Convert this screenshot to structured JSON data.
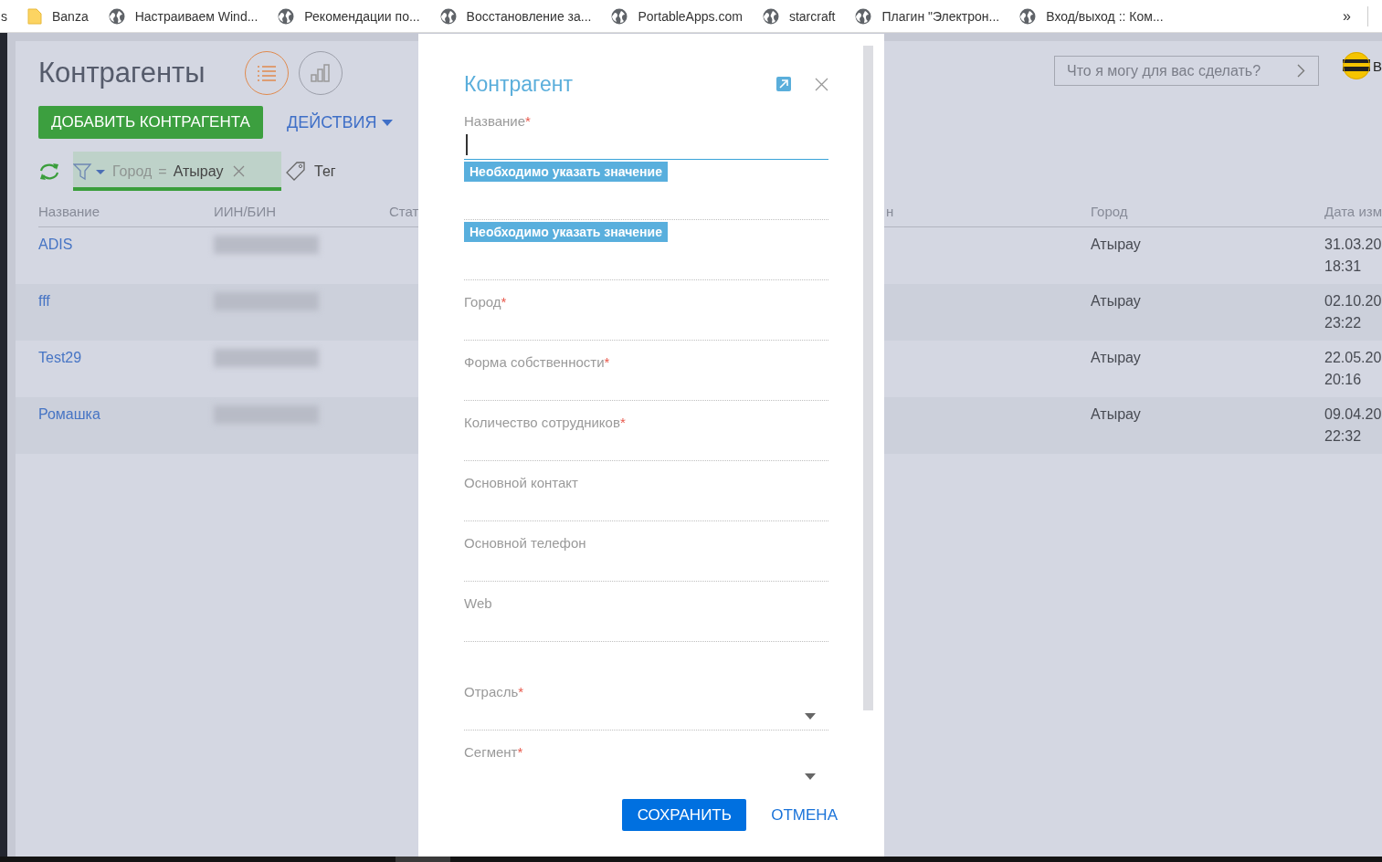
{
  "bookmarks": [
    {
      "label": "s",
      "kind": "plain"
    },
    {
      "label": "Banza",
      "kind": "folder"
    },
    {
      "label": "Настраиваем Wind...",
      "kind": "site"
    },
    {
      "label": "Рекомендации по...",
      "kind": "site"
    },
    {
      "label": "Восстановление за...",
      "kind": "site"
    },
    {
      "label": "PortableApps.com",
      "kind": "site"
    },
    {
      "label": "starcraft",
      "kind": "site"
    },
    {
      "label": "Плагин \"Электрон...",
      "kind": "site"
    },
    {
      "label": "Вход/выход :: Ком...",
      "kind": "site"
    }
  ],
  "bookmarks_more": "»",
  "page": {
    "title": "Контрагенты",
    "views": [
      {
        "kind": "list",
        "selected": true
      },
      {
        "kind": "chart",
        "selected": false
      }
    ],
    "add_button": "ДОБАВИТЬ КОНТРАГЕНТА",
    "actions": "ДЕЙСТВИЯ",
    "filter": {
      "field": "Город",
      "operator": "=",
      "value": "Атырау"
    },
    "tag": "Тег",
    "assistant": {
      "placeholder": "Что я могу для вас сделать?"
    },
    "logo_text": "B"
  },
  "table": {
    "columns": [
      "Название",
      "ИИН/БИН",
      "Стат",
      "н",
      "Город",
      "Дата изм"
    ],
    "rows": [
      {
        "name": "ADIS",
        "city": "Атырау",
        "date": "31.03.20",
        "time": "18:31"
      },
      {
        "name": "fff",
        "city": "Атырау",
        "date": "02.10.20",
        "time": "23:22"
      },
      {
        "name": "Test29",
        "city": "Атырау",
        "date": "22.05.20",
        "time": "20:16"
      },
      {
        "name": "Ромашка",
        "city": "Атырау",
        "date": "09.04.20",
        "time": "22:32"
      }
    ]
  },
  "dialog": {
    "title": "Контрагент",
    "required_mark": "*",
    "fields": [
      {
        "label": "Название",
        "required": true,
        "kind": "text",
        "focused": true,
        "error": "Необходимо указать значение"
      },
      {
        "kind": "text",
        "focused": false,
        "error": "Необходимо указать значение"
      },
      {
        "kind": "text",
        "focused": false
      },
      {
        "label": "Город",
        "required": true,
        "kind": "text",
        "focused": false
      },
      {
        "label": "Форма собственности",
        "required": true,
        "kind": "text",
        "focused": false
      },
      {
        "label": "Количество сотрудников",
        "required": true,
        "kind": "text",
        "focused": false
      },
      {
        "label": "Основной контакт",
        "required": false,
        "kind": "text",
        "focused": false
      },
      {
        "label": "Основной телефон",
        "required": false,
        "kind": "text",
        "focused": false
      },
      {
        "label": "Web",
        "required": false,
        "kind": "text",
        "focused": false
      },
      {
        "label": "Отрасль",
        "required": true,
        "kind": "lookup",
        "focused": false
      },
      {
        "label": "Сегмент",
        "required": true,
        "kind": "lookup",
        "focused": false
      }
    ],
    "buttons": [
      {
        "label": "СОХРАНИТЬ",
        "kind": "primary"
      },
      {
        "label": "ОТМЕНА",
        "kind": "link"
      }
    ]
  }
}
